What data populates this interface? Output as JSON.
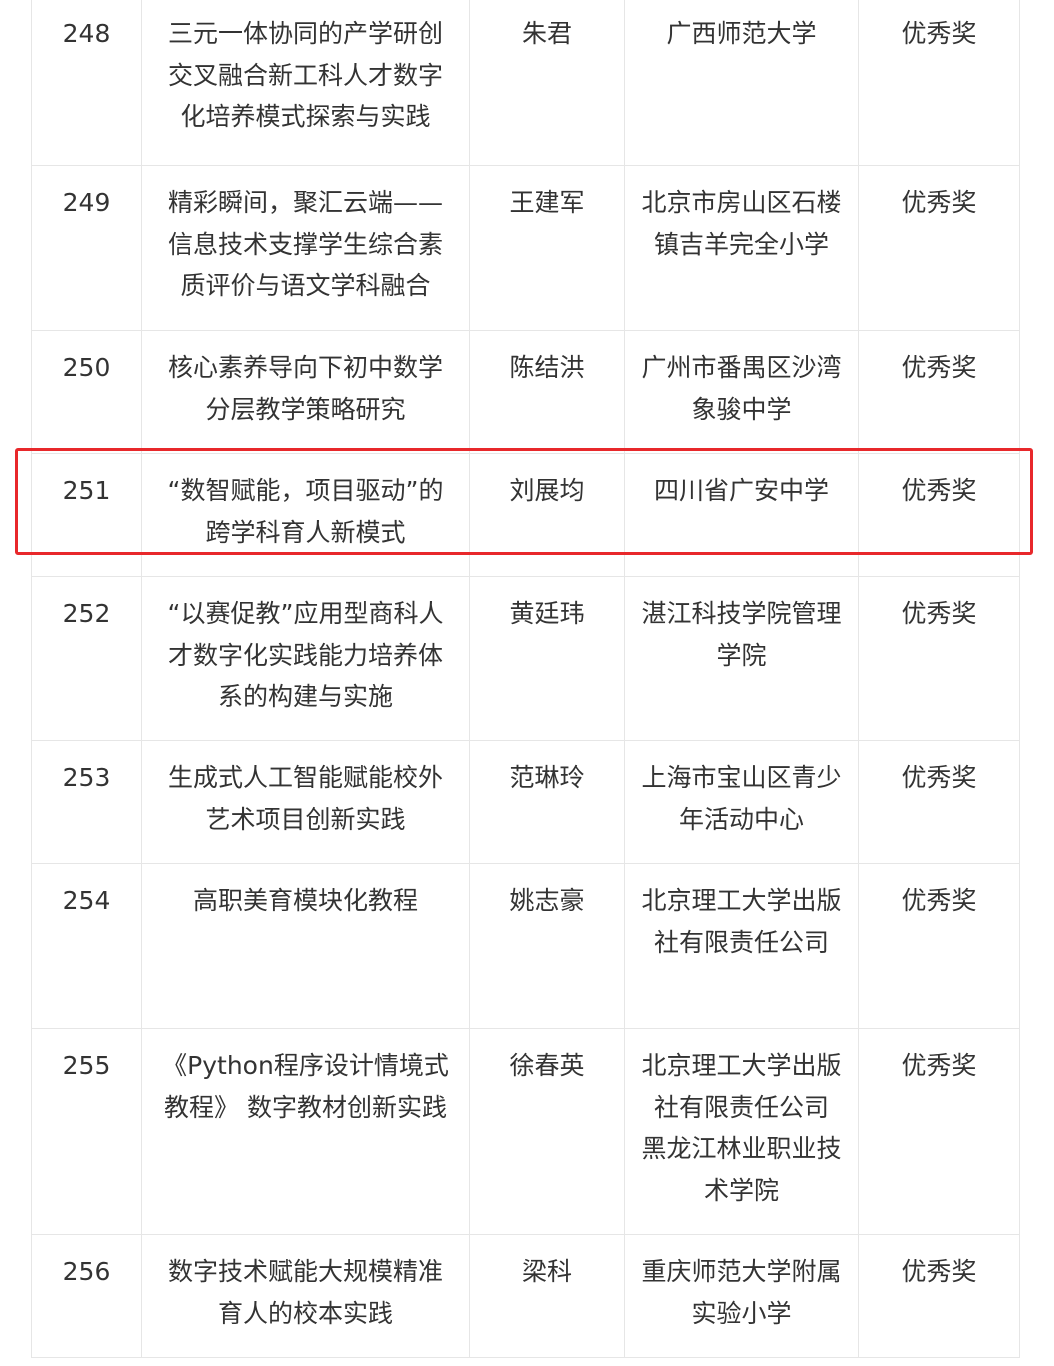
{
  "table": {
    "rows": [
      {
        "no": "248",
        "title": "三元一体协同的产学研创交叉融合新工科人才数字化培养模式探索与实践",
        "author": "朱君",
        "org": "广西师范大学",
        "award": "优秀奖"
      },
      {
        "no": "249",
        "title": "精彩瞬间，聚汇云端——信息技术支撑学生综合素质评价与语文学科融合",
        "author": "王建军",
        "org": "北京市房山区石楼镇吉羊完全小学",
        "award": "优秀奖"
      },
      {
        "no": "250",
        "title": "核心素养导向下初中数学分层教学策略研究",
        "author": "陈结洪",
        "org": "广州市番禺区沙湾象骏中学",
        "award": "优秀奖"
      },
      {
        "no": "251",
        "title": "“数智赋能，项目驱动”的跨学科育人新模式",
        "author": "刘展均",
        "org": "四川省广安中学",
        "award": "优秀奖"
      },
      {
        "no": "252",
        "title": "“以赛促教”应用型商科人才数字化实践能力培养体系的构建与实施",
        "author": "黄廷玮",
        "org": "湛江科技学院管理学院",
        "award": "优秀奖"
      },
      {
        "no": "253",
        "title": "生成式人工智能赋能校外艺术项目创新实践",
        "author": "范琳玲",
        "org": "上海市宝山区青少年活动中心",
        "award": "优秀奖"
      },
      {
        "no": "254",
        "title": "高职美育模块化教程",
        "author": "姚志豪",
        "org": "北京理工大学出版社有限责任公司",
        "award": "优秀奖"
      },
      {
        "no": "255",
        "title": "《Python程序设计情境式教程》 数字教材创新实践",
        "author": "徐春英",
        "org": "北京理工大学出版社有限责任公司 黑龙江林业职业技术学院",
        "award": "优秀奖"
      },
      {
        "no": "256",
        "title": "数字技术赋能大规模精准育人的校本实践",
        "author": "梁科",
        "org": "重庆师范大学附属实验小学",
        "award": "优秀奖"
      }
    ]
  },
  "colors": {
    "text": "#333333",
    "border": "#e6e6e6",
    "highlight": "#e8282b"
  }
}
